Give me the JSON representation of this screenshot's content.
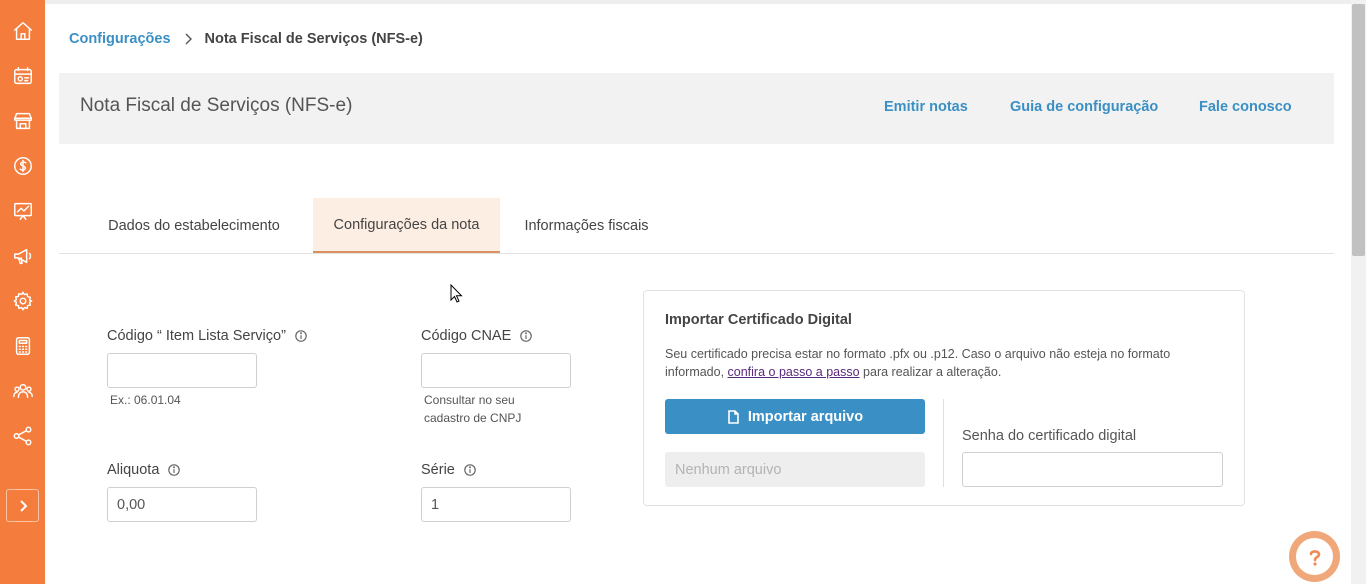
{
  "breadcrumb": {
    "parent": "Configurações",
    "current": "Nota Fiscal de Serviços (NFS-e)"
  },
  "header": {
    "title": "Nota Fiscal de Serviços (NFS-e)",
    "links": {
      "emit": "Emitir notas",
      "guide": "Guia de configuração",
      "contact": "Fale conosco"
    }
  },
  "tabs": {
    "establishment": "Dados do estabelecimento",
    "note_settings": "Configurações da nota",
    "fiscal_info": "Informações fiscais"
  },
  "form": {
    "item_code": {
      "label": "Código “ Item Lista Serviço”",
      "value": "",
      "hint": "Ex.: 06.01.04"
    },
    "cnae": {
      "label": "Código CNAE",
      "value": "",
      "hint_line1": "Consultar no seu",
      "hint_line2": "cadastro de CNPJ"
    },
    "rate": {
      "label": "Aliquota",
      "value": "0,00"
    },
    "series": {
      "label": "Série",
      "value": "1"
    }
  },
  "certificate": {
    "title": "Importar Certificado Digital",
    "desc_part1": "Seu certificado precisa estar no formato .pfx ou .p12. Caso o arquivo não esteja no formato informado, ",
    "desc_link": "confira o passo a passo",
    "desc_part2": " para realizar a alteração.",
    "import_label": "Importar arquivo",
    "no_file": "Nenhum arquivo",
    "password_label": "Senha do certificado digital"
  },
  "colors": {
    "sidebar": "#f47c3c",
    "accent_blue": "#3a8fc4",
    "active_tab_bg": "#fdeee4"
  },
  "icons": {
    "sidebar": [
      "home-icon",
      "dashboard-icon",
      "store-icon",
      "dollar-icon",
      "chart-icon",
      "megaphone-icon",
      "gear-icon",
      "calculator-icon",
      "users-icon",
      "share-icon"
    ],
    "expand": "chevron-right-icon",
    "help": "question-icon"
  }
}
